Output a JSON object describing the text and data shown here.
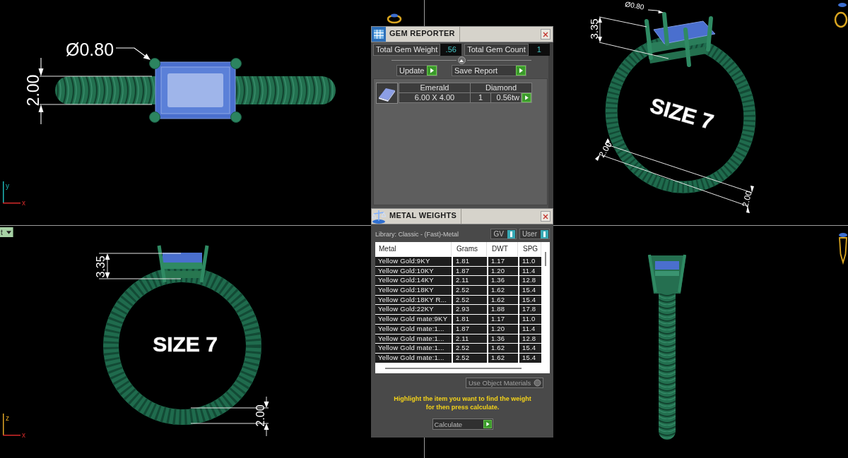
{
  "viewports": [
    {
      "kind": "top",
      "labels": [
        {
          "kind": "dimension",
          "text": "Ø0.80"
        },
        {
          "kind": "dimension",
          "text": "2.00"
        }
      ],
      "axes": [
        {
          "label": "y",
          "color": "#1fb5b5"
        },
        {
          "label": "x",
          "color": "#d42a2a"
        }
      ]
    },
    {
      "kind": "perspective",
      "labels": [
        {
          "kind": "dimension",
          "text": "3.35"
        },
        {
          "kind": "engraving",
          "text": "SIZE 7"
        },
        {
          "kind": "dimension",
          "text": "2.00"
        },
        {
          "kind": "dimension",
          "text": "2.00"
        },
        {
          "kind": "dimension",
          "text": "Ø0.80"
        }
      ]
    },
    {
      "kind": "front",
      "menu": "t",
      "labels": [
        {
          "kind": "dimension",
          "text": "3.35"
        },
        {
          "kind": "engraving",
          "text": "SIZE 7"
        },
        {
          "kind": "dimension",
          "text": "2.00"
        }
      ],
      "axes": [
        {
          "label": "z",
          "color": "#e0a526"
        },
        {
          "label": "x",
          "color": "#d42a2a"
        }
      ]
    },
    {
      "kind": "side"
    }
  ],
  "gem_reporter": {
    "title": "GEM REPORTER",
    "stats": [
      {
        "label": "Total Gem Weight",
        "value": ".56"
      },
      {
        "label": "Total Gem Count",
        "value": "1"
      }
    ],
    "buttons": [
      "Update",
      "Save Report"
    ],
    "gems": [
      {
        "shape": "Emerald",
        "size": "6.00 X 4.00",
        "type": "Diamond",
        "count": "1",
        "weight": "0.56tw"
      }
    ]
  },
  "metal_weights": {
    "title": "METAL WEIGHTS",
    "library": "Library: Classic - (Fast)-Metal",
    "toggles": [
      {
        "label": "GV",
        "on": true
      },
      {
        "label": "User",
        "on": true
      }
    ],
    "columns": [
      "Metal",
      "Grams",
      "DWT",
      "SPG"
    ],
    "rows": [
      [
        "Yellow Gold:9KY",
        "1.81",
        "1.17",
        "11.0"
      ],
      [
        "Yellow Gold:10KY",
        "1.87",
        "1.20",
        "11.4"
      ],
      [
        "Yellow Gold:14KY",
        "2.11",
        "1.36",
        "12.8"
      ],
      [
        "Yellow Gold:18KY",
        "2.52",
        "1.62",
        "15.4"
      ],
      [
        "Yellow Gold:18KY R...",
        "2.52",
        "1.62",
        "15.4"
      ],
      [
        "Yellow Gold:22KY",
        "2.93",
        "1.88",
        "17.8"
      ],
      [
        "Yellow Gold mate:9KY",
        "1.81",
        "1.17",
        "11.0"
      ],
      [
        "Yellow Gold mate:1...",
        "1.87",
        "1.20",
        "11.4"
      ],
      [
        "Yellow Gold mate:1...",
        "2.11",
        "1.36",
        "12.8"
      ],
      [
        "Yellow Gold mate:1...",
        "2.52",
        "1.62",
        "15.4"
      ],
      [
        "Yellow Gold mate:1...",
        "2.52",
        "1.62",
        "15.4"
      ]
    ],
    "material_select": "Use Object Materials",
    "hint": "Highlight the item you want to find the weight for then press calculate.",
    "button": "Calculate"
  }
}
